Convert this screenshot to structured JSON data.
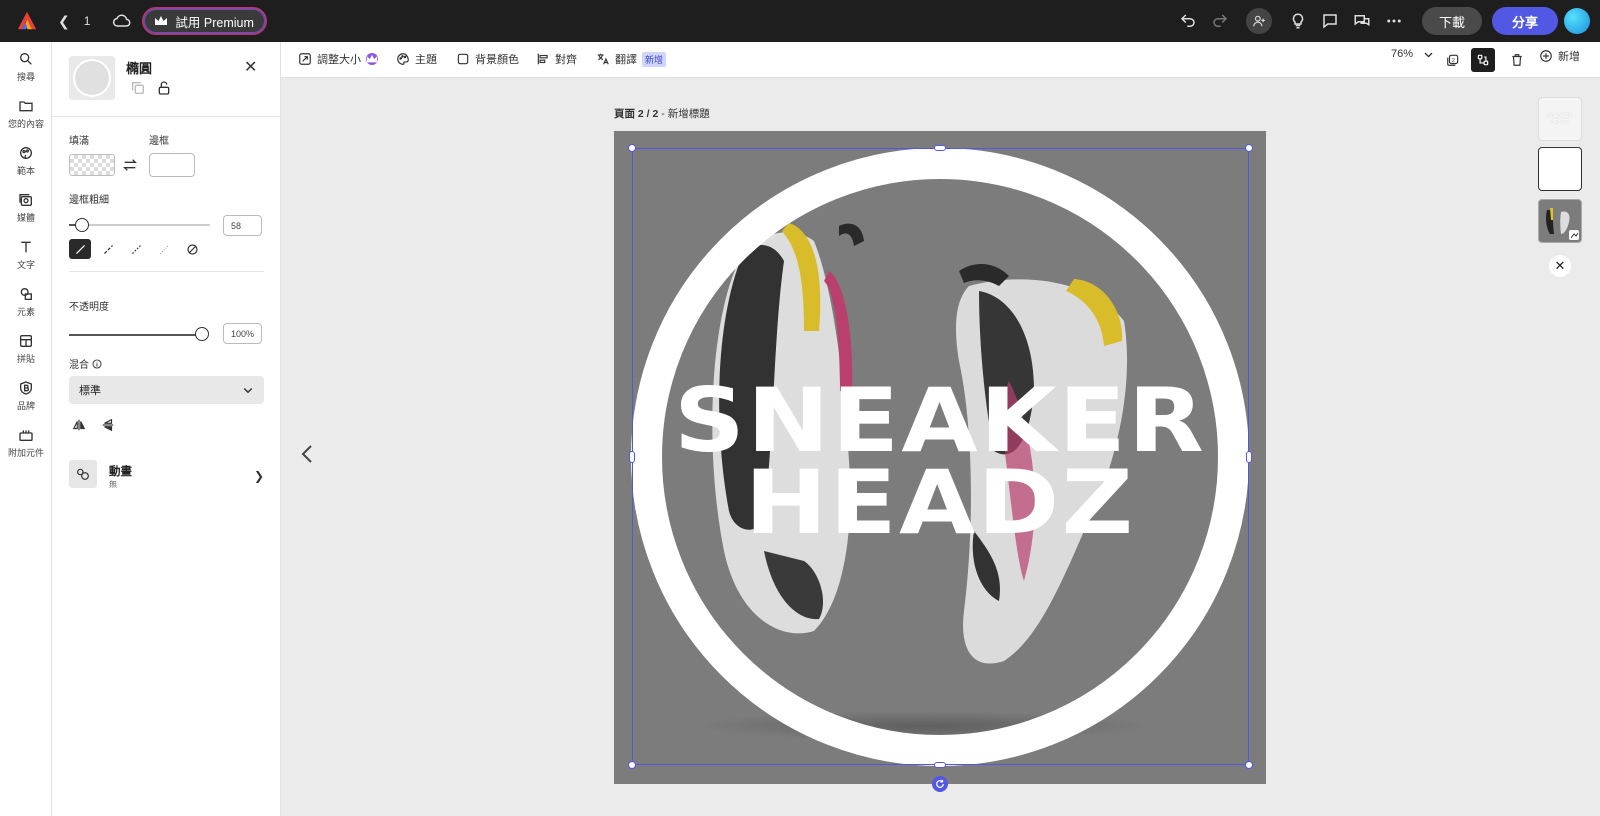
{
  "topbar": {
    "page_number": "1",
    "premium_label": "試用 Premium",
    "download_label": "下載",
    "share_label": "分享"
  },
  "rail": {
    "items": [
      {
        "label": "搜尋",
        "icon": "search-icon"
      },
      {
        "label": "您的內容",
        "icon": "folder-icon"
      },
      {
        "label": "範本",
        "icon": "templates-icon"
      },
      {
        "label": "媒體",
        "icon": "media-icon"
      },
      {
        "label": "文字",
        "icon": "text-icon"
      },
      {
        "label": "元素",
        "icon": "shapes-icon"
      },
      {
        "label": "拼貼",
        "icon": "grid-icon"
      },
      {
        "label": "品牌",
        "icon": "brand-icon"
      },
      {
        "label": "附加元件",
        "icon": "addons-icon"
      }
    ]
  },
  "panel": {
    "title": "橢圓",
    "fill_label": "填滿",
    "stroke_label": "邊框",
    "stroke_width_label": "邊框粗細",
    "stroke_width_value": "58",
    "opacity_label": "不透明度",
    "opacity_value": "100%",
    "blend_label": "混合",
    "blend_value": "標準",
    "animation_label": "動畫",
    "animation_value": "無"
  },
  "toolbar2": {
    "resize_label": "調整大小",
    "theme_label": "主題",
    "bg_color_label": "背景顏色",
    "align_label": "對齊",
    "translate_label": "翻譯",
    "new_badge": "新增",
    "zoom": "76%",
    "page_count": "2",
    "add_label": "新增"
  },
  "canvas": {
    "page_label_bold": "頁面 2 / 2",
    "page_label_rest": " - 新增標題",
    "title_line1": "SNEAKER",
    "title_line2": "HEADZ"
  },
  "thumbs": {
    "t1_text": "SNEAKER HEADZ"
  },
  "colors": {
    "accent": "#5258e4",
    "topbar_bg": "#1e1e1e",
    "artboard_bg": "#7c7c7d"
  }
}
